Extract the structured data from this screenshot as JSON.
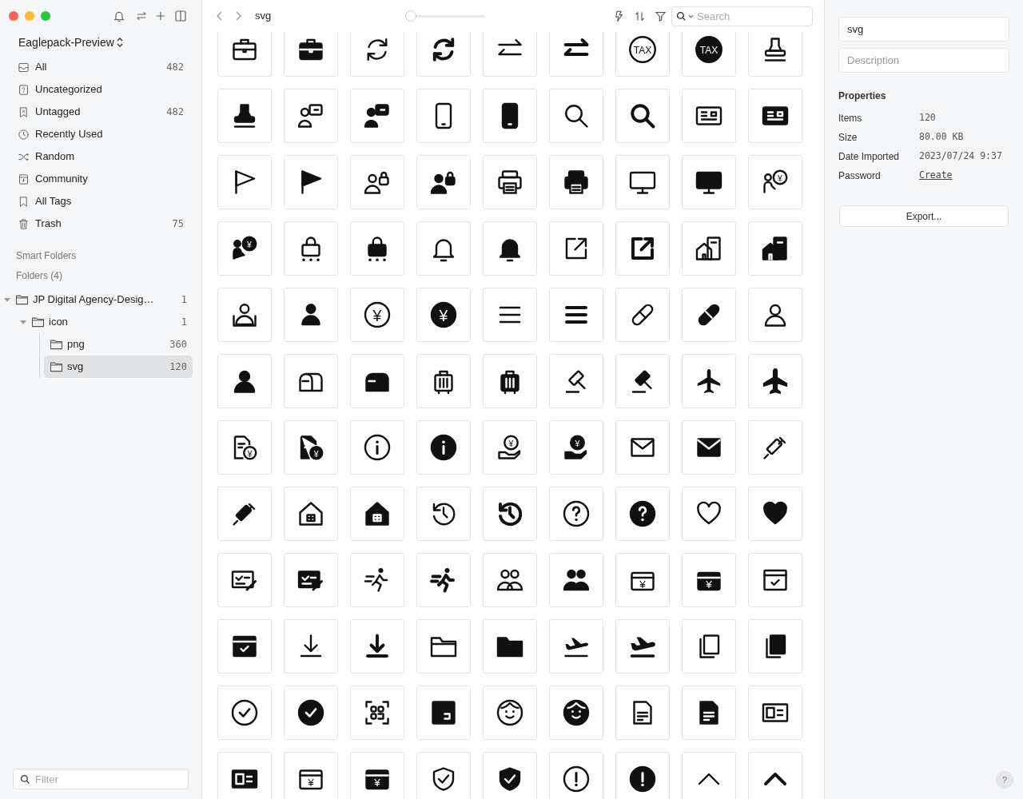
{
  "window": {
    "library": "Eaglepack-Preview"
  },
  "sidebar": {
    "items": [
      {
        "label": "All",
        "count": "482",
        "kind": "all",
        "selected": false
      },
      {
        "label": "Uncategorized",
        "kind": "uncategorized",
        "selected": false
      },
      {
        "label": "Untagged",
        "count": "482",
        "kind": "untagged",
        "selected": false
      },
      {
        "label": "Recently Used",
        "kind": "recent",
        "selected": false
      },
      {
        "label": "Random",
        "kind": "random",
        "selected": false
      },
      {
        "label": "Community",
        "kind": "community",
        "selected": false
      },
      {
        "label": "All Tags",
        "kind": "tags",
        "selected": false
      },
      {
        "label": "Trash",
        "count": "75",
        "kind": "trash",
        "selected": false
      }
    ],
    "sections": [
      "Smart Folders",
      "Folders (4)"
    ],
    "folders": [
      {
        "label": "JP Digital Agency-Desig…",
        "count": "1",
        "expanded": true,
        "selected": false,
        "children": [
          {
            "label": "icon",
            "count": "1",
            "expanded": true,
            "selected": false,
            "children": [
              {
                "label": "png",
                "count": "360",
                "selected": false
              },
              {
                "label": "svg",
                "count": "120",
                "selected": true
              }
            ]
          }
        ]
      }
    ],
    "filter": {
      "placeholder": "Filter"
    }
  },
  "toolbar": {
    "path": "svg",
    "zoom": {
      "level": 0
    },
    "search": {
      "placeholder": "Search"
    }
  },
  "grid": {
    "items": [
      {
        "kind": "briefcase",
        "filled": false
      },
      {
        "kind": "briefcase",
        "filled": true
      },
      {
        "kind": "refresh",
        "filled": false
      },
      {
        "kind": "refresh",
        "filled": true
      },
      {
        "kind": "swap",
        "filled": false
      },
      {
        "kind": "swap",
        "filled": true
      },
      {
        "kind": "tax",
        "filled": false,
        "glyph": "TAX"
      },
      {
        "kind": "tax",
        "filled": true,
        "glyph": "TAX"
      },
      {
        "kind": "stamp",
        "filled": false
      },
      {
        "kind": "stamp",
        "filled": true
      },
      {
        "kind": "presenter",
        "filled": false
      },
      {
        "kind": "presenter",
        "filled": true
      },
      {
        "kind": "tablet",
        "filled": false
      },
      {
        "kind": "tablet",
        "filled": true
      },
      {
        "kind": "search",
        "filled": false
      },
      {
        "kind": "search",
        "filled": true
      },
      {
        "kind": "idcard",
        "filled": false
      },
      {
        "kind": "idcard",
        "filled": true
      },
      {
        "kind": "flag",
        "filled": false
      },
      {
        "kind": "flag",
        "filled": true
      },
      {
        "kind": "userlock",
        "filled": false
      },
      {
        "kind": "userlock",
        "filled": true
      },
      {
        "kind": "printer",
        "filled": false
      },
      {
        "kind": "printer",
        "filled": true
      },
      {
        "kind": "monitor",
        "filled": false
      },
      {
        "kind": "monitor",
        "filled": true
      },
      {
        "kind": "consult",
        "filled": false,
        "glyph": "¥"
      },
      {
        "kind": "consult",
        "filled": true,
        "glyph": "¥"
      },
      {
        "kind": "padlock",
        "filled": false
      },
      {
        "kind": "padlock",
        "filled": true
      },
      {
        "kind": "bell",
        "filled": false
      },
      {
        "kind": "bell",
        "filled": true
      },
      {
        "kind": "external",
        "filled": false
      },
      {
        "kind": "external",
        "filled": true
      },
      {
        "kind": "office",
        "filled": false
      },
      {
        "kind": "office",
        "filled": true
      },
      {
        "kind": "badge",
        "filled": false
      },
      {
        "kind": "badge",
        "filled": true
      },
      {
        "kind": "yen",
        "filled": false,
        "glyph": "¥"
      },
      {
        "kind": "yen",
        "filled": true,
        "glyph": "¥"
      },
      {
        "kind": "menu",
        "filled": false
      },
      {
        "kind": "menu",
        "filled": true
      },
      {
        "kind": "pill",
        "filled": false
      },
      {
        "kind": "pill",
        "filled": true
      },
      {
        "kind": "person",
        "filled": false
      },
      {
        "kind": "person",
        "filled": true
      },
      {
        "kind": "mailbox",
        "filled": false
      },
      {
        "kind": "mailbox",
        "filled": true
      },
      {
        "kind": "luggage",
        "filled": false
      },
      {
        "kind": "luggage",
        "filled": true
      },
      {
        "kind": "gavel",
        "filled": false
      },
      {
        "kind": "gavel",
        "filled": true
      },
      {
        "kind": "airplane",
        "filled": false
      },
      {
        "kind": "airplane",
        "filled": true
      },
      {
        "kind": "invoice",
        "filled": false,
        "glyph": "¥"
      },
      {
        "kind": "invoice",
        "filled": true,
        "glyph": "¥"
      },
      {
        "kind": "info",
        "filled": false
      },
      {
        "kind": "info",
        "filled": true
      },
      {
        "kind": "payment",
        "filled": false,
        "glyph": "¥"
      },
      {
        "kind": "payment",
        "filled": true,
        "glyph": "¥"
      },
      {
        "kind": "mail",
        "filled": false
      },
      {
        "kind": "mail",
        "filled": true
      },
      {
        "kind": "syringe",
        "filled": false
      },
      {
        "kind": "syringe",
        "filled": true
      },
      {
        "kind": "house",
        "filled": false
      },
      {
        "kind": "house",
        "filled": true
      },
      {
        "kind": "history",
        "filled": false
      },
      {
        "kind": "history",
        "filled": true
      },
      {
        "kind": "help",
        "filled": false
      },
      {
        "kind": "help",
        "filled": true
      },
      {
        "kind": "heart",
        "filled": false
      },
      {
        "kind": "heart",
        "filled": true
      },
      {
        "kind": "checklist",
        "filled": false
      },
      {
        "kind": "checklist",
        "filled": true
      },
      {
        "kind": "runner",
        "filled": false
      },
      {
        "kind": "runner",
        "filled": true
      },
      {
        "kind": "group",
        "filled": false
      },
      {
        "kind": "group",
        "filled": true
      },
      {
        "kind": "cashbox",
        "filled": false,
        "glyph": "¥"
      },
      {
        "kind": "cashbox",
        "filled": true,
        "glyph": "¥"
      },
      {
        "kind": "browser",
        "filled": false
      },
      {
        "kind": "browser",
        "filled": true
      },
      {
        "kind": "download",
        "filled": false
      },
      {
        "kind": "download",
        "filled": true
      },
      {
        "kind": "folder",
        "filled": false
      },
      {
        "kind": "folder",
        "filled": true
      },
      {
        "kind": "takeoff",
        "filled": false
      },
      {
        "kind": "takeoff",
        "filled": true
      },
      {
        "kind": "copy",
        "filled": false
      },
      {
        "kind": "copy",
        "filled": true
      },
      {
        "kind": "check",
        "filled": false
      },
      {
        "kind": "check",
        "filled": true
      },
      {
        "kind": "qrcode",
        "filled": false
      },
      {
        "kind": "qrcode",
        "filled": true
      },
      {
        "kind": "face",
        "filled": false
      },
      {
        "kind": "face",
        "filled": true
      },
      {
        "kind": "document",
        "filled": false
      },
      {
        "kind": "document",
        "filled": true
      },
      {
        "kind": "profile",
        "filled": false
      },
      {
        "kind": "profile",
        "filled": true
      },
      {
        "kind": "register",
        "filled": false,
        "glyph": "¥"
      },
      {
        "kind": "register",
        "filled": true,
        "glyph": "¥"
      },
      {
        "kind": "shield",
        "filled": false
      },
      {
        "kind": "shield",
        "filled": true
      },
      {
        "kind": "alert",
        "filled": false
      },
      {
        "kind": "alert",
        "filled": true
      },
      {
        "kind": "chevron",
        "filled": false
      },
      {
        "kind": "chevron",
        "filled": true
      }
    ]
  },
  "inspector": {
    "name": "svg",
    "description": {
      "placeholder": "Description"
    },
    "properties_title": "Properties",
    "properties": [
      {
        "label": "Items",
        "value": "120",
        "kind": "text"
      },
      {
        "label": "Size",
        "value": "80.00 KB",
        "kind": "text"
      },
      {
        "label": "Date Imported",
        "value": "2023/07/24 9:37",
        "kind": "text"
      },
      {
        "label": "Password",
        "value": "Create",
        "kind": "link"
      }
    ],
    "export_button": "Export..."
  },
  "help_button": "?"
}
